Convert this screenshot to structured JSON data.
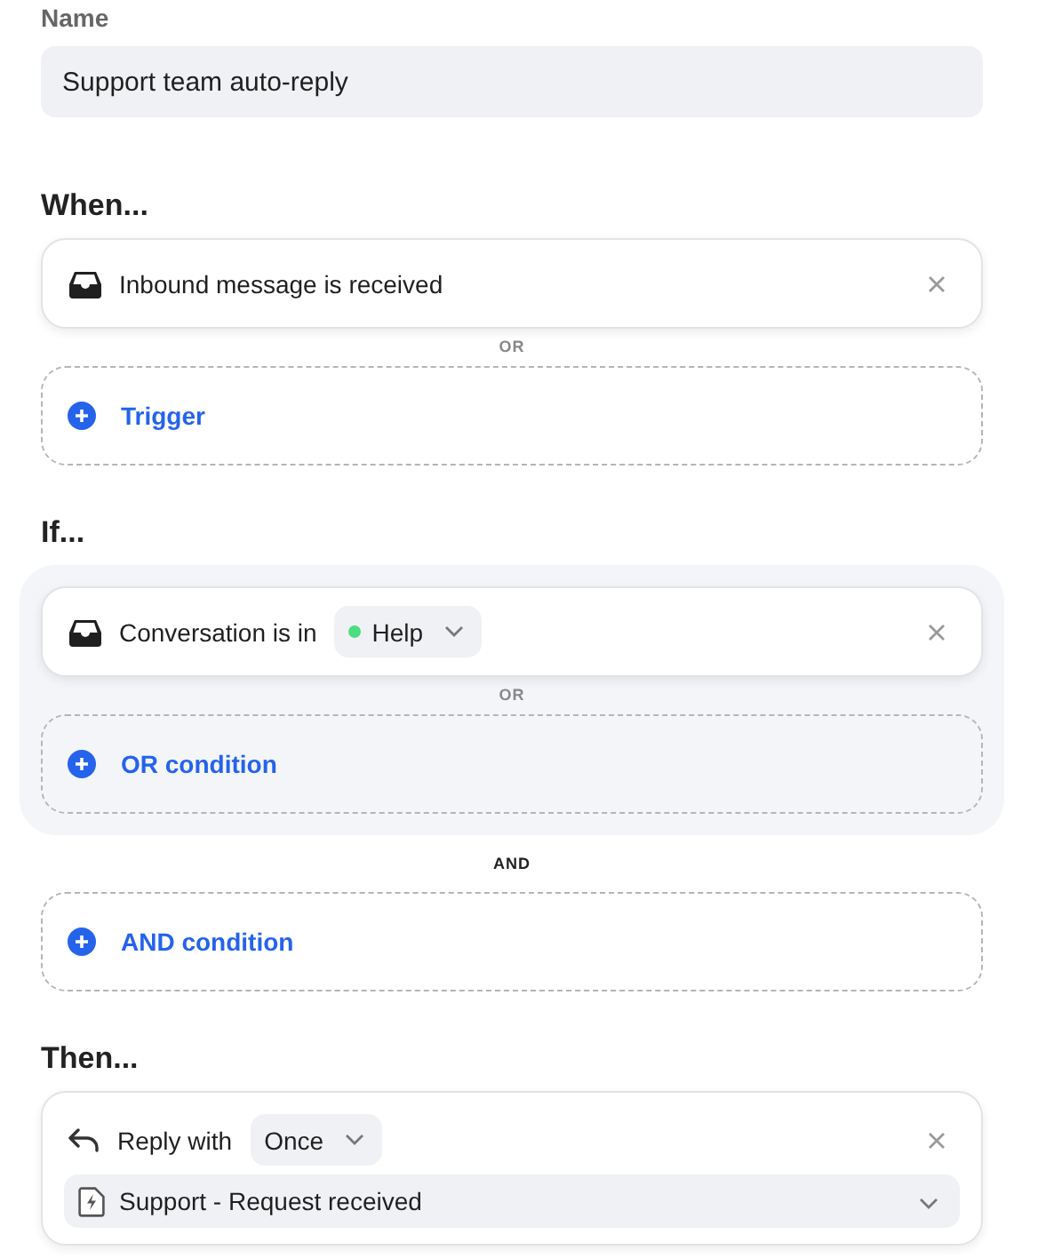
{
  "name": {
    "label": "Name",
    "value": "Support team auto-reply"
  },
  "sections": [
    {
      "heading": "When...",
      "blocks": [
        {
          "kind": "rule",
          "text": "Inbound message is received"
        },
        {
          "kind": "separator",
          "text": "OR"
        },
        {
          "kind": "add",
          "text": "Trigger"
        }
      ]
    },
    {
      "heading": "If...",
      "blocks": [
        {
          "kind": "group",
          "blocks": [
            {
              "kind": "rule",
              "text": "Conversation is in",
              "chip": {
                "label": "Help",
                "color": "#4ade80"
              }
            },
            {
              "kind": "separator",
              "text": "OR"
            },
            {
              "kind": "add",
              "text": "OR condition"
            }
          ]
        },
        {
          "kind": "join",
          "text": "AND"
        },
        {
          "kind": "add",
          "text": "AND condition"
        }
      ]
    },
    {
      "heading": "Then...",
      "blocks": [
        {
          "kind": "action",
          "text": "Reply with",
          "select": "Once",
          "template": "Support - Request received"
        }
      ]
    }
  ]
}
